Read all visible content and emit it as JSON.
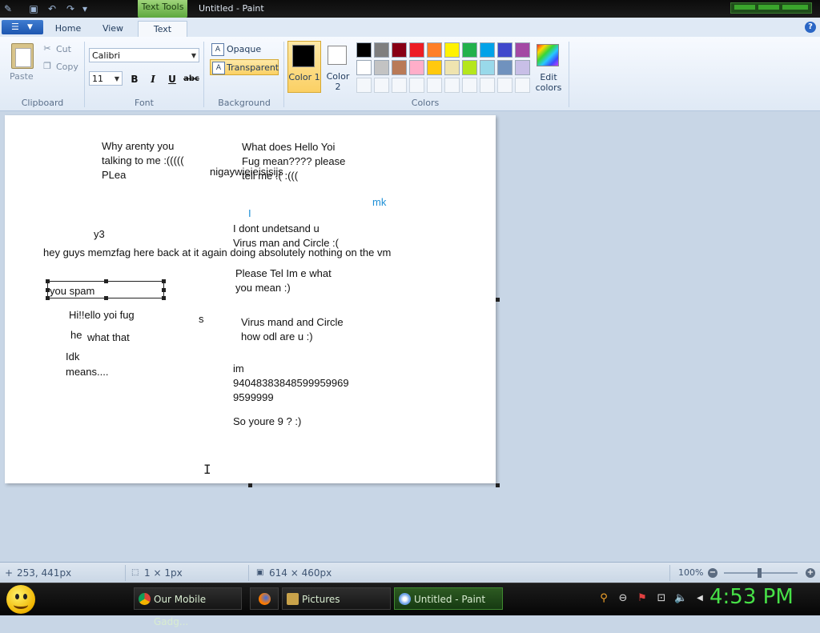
{
  "window": {
    "title": "Untitled - Paint",
    "context_tab": "Text Tools"
  },
  "tabs": {
    "home": "Home",
    "view": "View",
    "text": "Text"
  },
  "clipboard": {
    "paste": "Paste",
    "cut": "Cut",
    "copy": "Copy",
    "group": "Clipboard"
  },
  "font": {
    "family": "Calibri",
    "size": "11",
    "group": "Font",
    "bold": "B",
    "italic": "I",
    "underline": "U",
    "strike": "abc"
  },
  "background": {
    "opaque": "Opaque",
    "transparent": "Transparent",
    "group": "Background"
  },
  "colors": {
    "color1_label": "Color 1",
    "color1_value": "#000000",
    "color2_label": "Color 2",
    "color2_value": "#ffffff",
    "edit_label": "Edit colors",
    "group": "Colors",
    "palette_row1": [
      "#000000",
      "#7f7f7f",
      "#880015",
      "#ed1c24",
      "#ff7f27",
      "#fff200",
      "#22b14c",
      "#00a2e8",
      "#3f48cc",
      "#a349a4"
    ],
    "palette_row2": [
      "#ffffff",
      "#c3c3c3",
      "#b97a57",
      "#ffaec9",
      "#ffc90e",
      "#efe4b0",
      "#b5e61d",
      "#99d9ea",
      "#7092be",
      "#c8bfe7"
    ]
  },
  "canvas_text": [
    "Why arenty you",
    "talking to me :(((((",
    "PLea",
    "nigaywieieisisijs",
    "What does Hello Yoi",
    "Fug mean???? please",
    "tell me :( :(((",
    "mk",
    "I",
    "y3",
    "I dont undetsand u",
    "Virus man and Circle :(",
    "hey guys memzfag here back at it again doing absolutely nothing on the vm",
    "Please Tel Im e what",
    "you mean :)",
    "you spam",
    "Hi!!ello yoi fug",
    "s",
    "he",
    "what that",
    "Virus mand and Circle",
    "how odl are u :)",
    "Idk",
    "means....",
    "im",
    "94048383848599959969",
    "9599999",
    "So youre 9 ? :)"
  ],
  "status": {
    "cursor_pos": "253, 441px",
    "selection": "1 × 1px",
    "canvas_size": "614 × 460px",
    "zoom": "100%"
  },
  "taskbar": {
    "task_browser": "Our Mobile Gadg...",
    "task_pictures": "Pictures",
    "task_paint": "Untitled - Paint",
    "clock": "4:53 PM"
  }
}
